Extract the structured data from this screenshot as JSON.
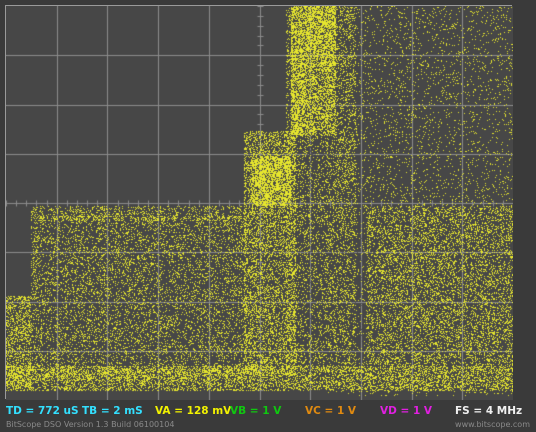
{
  "status": {
    "td": "TD = 772 uS",
    "tb": "TB = 2 mS",
    "va": "VA = 128 mV",
    "vb": "VB = 1 V",
    "vc": "VC = 1 V",
    "vd": "VD = 1 V",
    "fs": "FS = 4 MHz"
  },
  "footer": {
    "version": "BitScope DSO Version 1.3 Build 06100104",
    "url": "www.bitscope.com"
  },
  "colors": {
    "td": "#33e0ff",
    "tb": "#33e0ff",
    "va": "#f2f200",
    "vb": "#10c810",
    "vc": "#e08a10",
    "vd": "#e020e0",
    "fs": "#f0f0f0",
    "trace": "#e6e62e",
    "grid": "#8c8c8c",
    "background": "#474747"
  }
}
